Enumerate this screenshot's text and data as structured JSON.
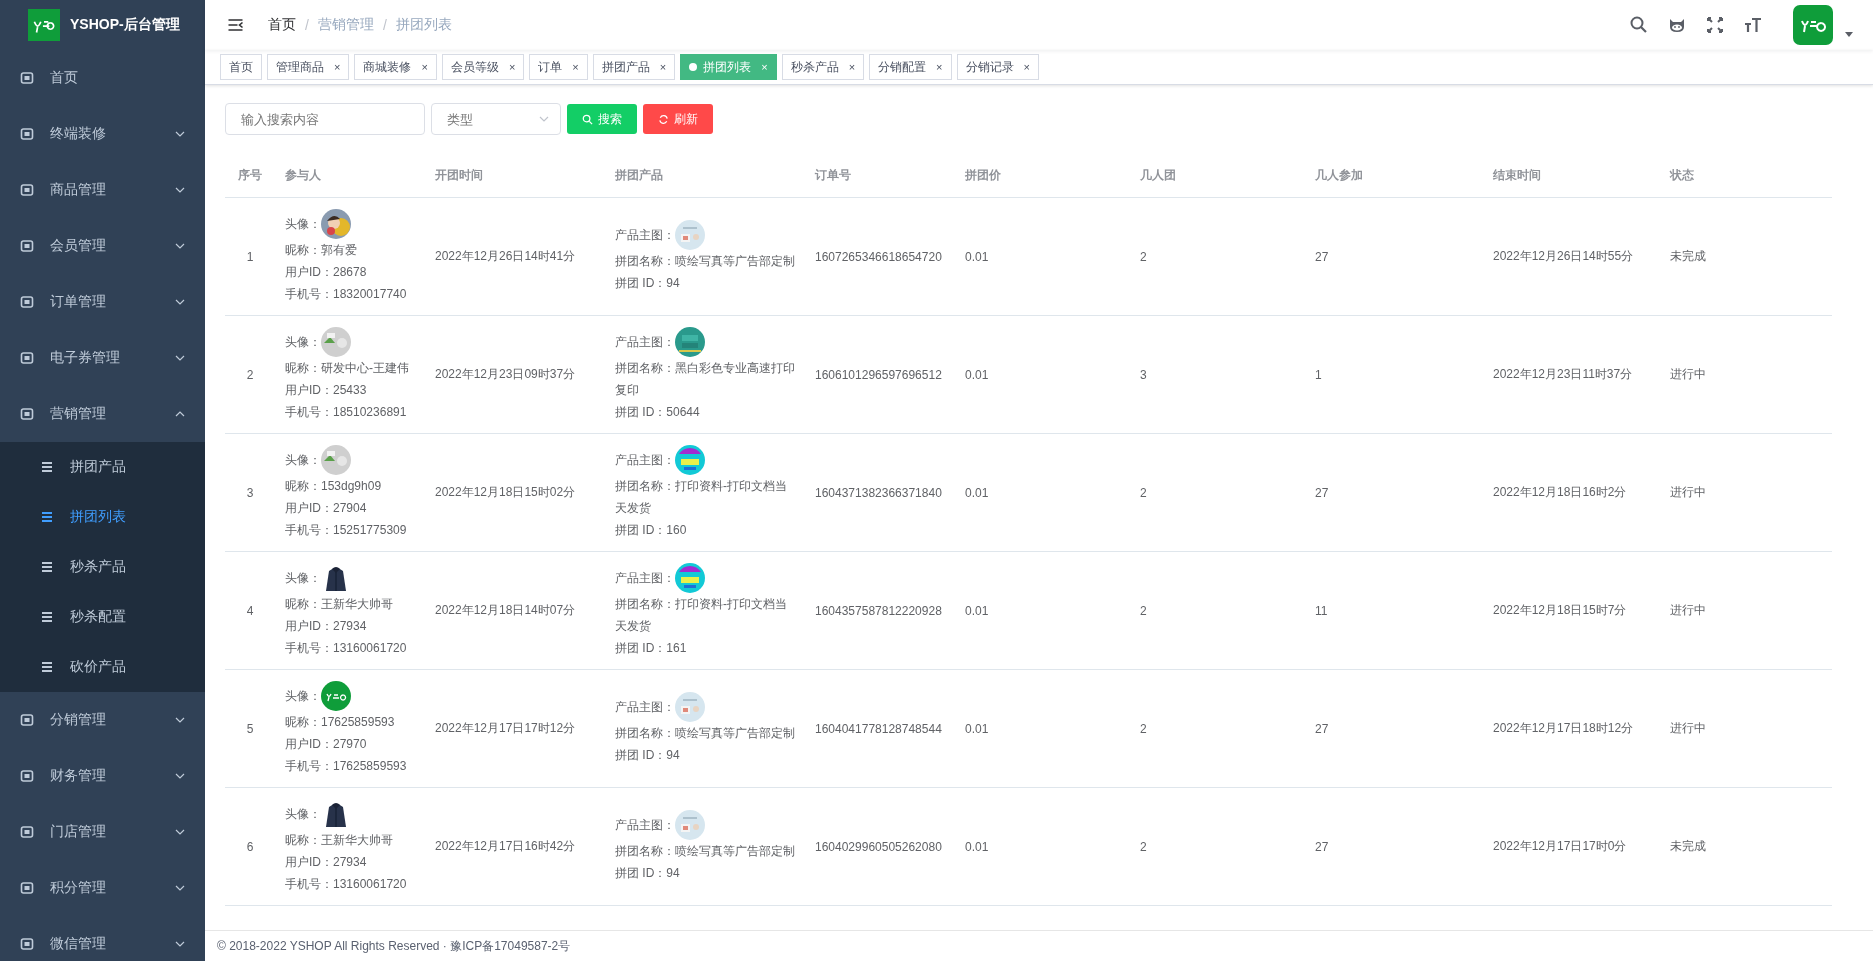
{
  "app": {
    "title": "YSHOP-后台管理"
  },
  "sidebar": {
    "items": [
      {
        "label": "首页",
        "has_children": false
      },
      {
        "label": "终端装修",
        "expanded": false,
        "has_children": true
      },
      {
        "label": "商品管理",
        "expanded": false,
        "has_children": true
      },
      {
        "label": "会员管理",
        "expanded": false,
        "has_children": true
      },
      {
        "label": "订单管理",
        "expanded": false,
        "has_children": true
      },
      {
        "label": "电子券管理",
        "expanded": false,
        "has_children": true
      },
      {
        "label": "营销管理",
        "expanded": true,
        "has_children": true,
        "children": [
          {
            "label": "拼团产品",
            "selected": false
          },
          {
            "label": "拼团列表",
            "selected": true
          },
          {
            "label": "秒杀产品",
            "selected": false
          },
          {
            "label": "秒杀配置",
            "selected": false
          },
          {
            "label": "砍价产品",
            "selected": false
          }
        ]
      },
      {
        "label": "分销管理",
        "expanded": false,
        "has_children": true
      },
      {
        "label": "财务管理",
        "expanded": false,
        "has_children": true
      },
      {
        "label": "门店管理",
        "expanded": false,
        "has_children": true
      },
      {
        "label": "积分管理",
        "expanded": false,
        "has_children": true
      },
      {
        "label": "微信管理",
        "expanded": false,
        "has_children": true
      }
    ]
  },
  "breadcrumb": [
    {
      "label": "首页"
    },
    {
      "separator": "/",
      "label": "营销管理"
    },
    {
      "separator": "/",
      "label": "拼团列表"
    }
  ],
  "tags": [
    {
      "label": "首页",
      "closable": false,
      "selected": false
    },
    {
      "label": "管理商品",
      "closable": true,
      "selected": false
    },
    {
      "label": "商城装修",
      "closable": true,
      "selected": false
    },
    {
      "label": "会员等级",
      "closable": true,
      "selected": false
    },
    {
      "label": "订单",
      "closable": true,
      "selected": false
    },
    {
      "label": "拼团产品",
      "closable": true,
      "selected": false
    },
    {
      "label": "拼团列表",
      "closable": true,
      "selected": true
    },
    {
      "label": "秒杀产品",
      "closable": true,
      "selected": false
    },
    {
      "label": "分销配置",
      "closable": true,
      "selected": false
    },
    {
      "label": "分销记录",
      "closable": true,
      "selected": false
    }
  ],
  "close_mark": "×",
  "filters": {
    "search": {
      "placeholder": "输入搜索内容"
    },
    "type": {
      "placeholder": "类型"
    },
    "search_button": "搜索",
    "refresh_button": "刷新"
  },
  "table": {
    "columns": [
      "序号",
      "参与人",
      "开团时间",
      "拼团产品",
      "订单号",
      "拼团价",
      "几人团",
      "几人参加",
      "结束时间",
      "状态"
    ],
    "rows": [
      {
        "index": "1",
        "avatar_label": "头像：",
        "nickname": "昵称：郭有爱",
        "user_id": "用户ID：28678",
        "phone": "手机号：18320017740",
        "start": "2022年12月26日14时41分",
        "image_label": "产品主图：",
        "image": {
          "kind": "poster"
        },
        "product": "拼团名称：喷绘写真等广告部定制",
        "product_id": "拼团 ID：94",
        "order": "1607265346618654720",
        "price": "0.01",
        "size": "2",
        "joined": "27",
        "end": "2022年12月26日14时55分",
        "status": "未完成"
      },
      {
        "index": "2",
        "avatar_label": "头像：",
        "avatar": {
          "kind": "placeholder"
        },
        "nickname": "昵称：研发中心-王建伟",
        "user_id": "用户ID：25433",
        "phone": "手机号：18510236891",
        "start": "2022年12月23日09时37分",
        "image_label": "产品主图：",
        "image": {
          "kind": "teal"
        },
        "product": "拼团名称：黑白彩色专业高速打印复印",
        "product_id": "拼团 ID：50644",
        "order": "1606101296597696512",
        "price": "0.01",
        "size": "3",
        "joined": "1",
        "end": "2022年12月23日11时37分",
        "status": "进行中"
      },
      {
        "index": "3",
        "avatar_label": "头像：",
        "avatar": {
          "kind": "placeholder"
        },
        "nickname": "昵称：153dg9h09",
        "user_id": "用户ID：27904",
        "phone": "手机号：15251775309",
        "start": "2022年12月18日15时02分",
        "image_label": "产品主图：",
        "image": {
          "kind": "colorful"
        },
        "product": "拼团名称：打印资料-打印文档当天发货",
        "product_id": "拼团 ID：160",
        "order": "1604371382366371840",
        "price": "0.01",
        "size": "2",
        "joined": "27",
        "end": "2022年12月18日16时2分",
        "status": "进行中"
      },
      {
        "index": "4",
        "avatar_label": "头像：",
        "avatar": {
          "kind": "jacket"
        },
        "nickname": "昵称：王新华大帅哥",
        "user_id": "用户ID：27934",
        "phone": "手机号：13160061720",
        "start": "2022年12月18日14时07分",
        "image_label": "产品主图：",
        "image": {
          "kind": "colorful"
        },
        "product": "拼团名称：打印资料-打印文档当天发货",
        "product_id": "拼团 ID：161",
        "order": "1604357587812220928",
        "price": "0.01",
        "size": "2",
        "joined": "11",
        "end": "2022年12月18日15时7分",
        "status": "进行中"
      },
      {
        "index": "5",
        "avatar_label": "头像：",
        "avatar": {
          "kind": "logo"
        },
        "nickname": "昵称：17625859593",
        "user_id": "用户ID：27970",
        "phone": "手机号：17625859593",
        "start": "2022年12月17日17时12分",
        "image_label": "产品主图：",
        "image": {
          "kind": "poster"
        },
        "product": "拼团名称：喷绘写真等广告部定制",
        "product_id": "拼团 ID：94",
        "order": "1604041778128748544",
        "price": "0.01",
        "size": "2",
        "joined": "27",
        "end": "2022年12月17日18时12分",
        "status": "进行中"
      },
      {
        "index": "6",
        "avatar_label": "头像：",
        "avatar": {
          "kind": "jacket"
        },
        "nickname": "昵称：王新华大帅哥",
        "user_id": "用户ID：27934",
        "phone": "手机号：13160061720",
        "start": "2022年12月17日16时42分",
        "image_label": "产品主图：",
        "image": {
          "kind": "poster"
        },
        "product": "拼团名称：喷绘写真等广告部定制",
        "product_id": "拼团 ID：94",
        "order": "1604029960505262080",
        "price": "0.01",
        "size": "2",
        "joined": "27",
        "end": "2022年12月17日17时0分",
        "status": "未完成"
      }
    ]
  },
  "footer": "© 2018-2022 YSHOP All Rights Reserved · 豫ICP备17049587-2号"
}
